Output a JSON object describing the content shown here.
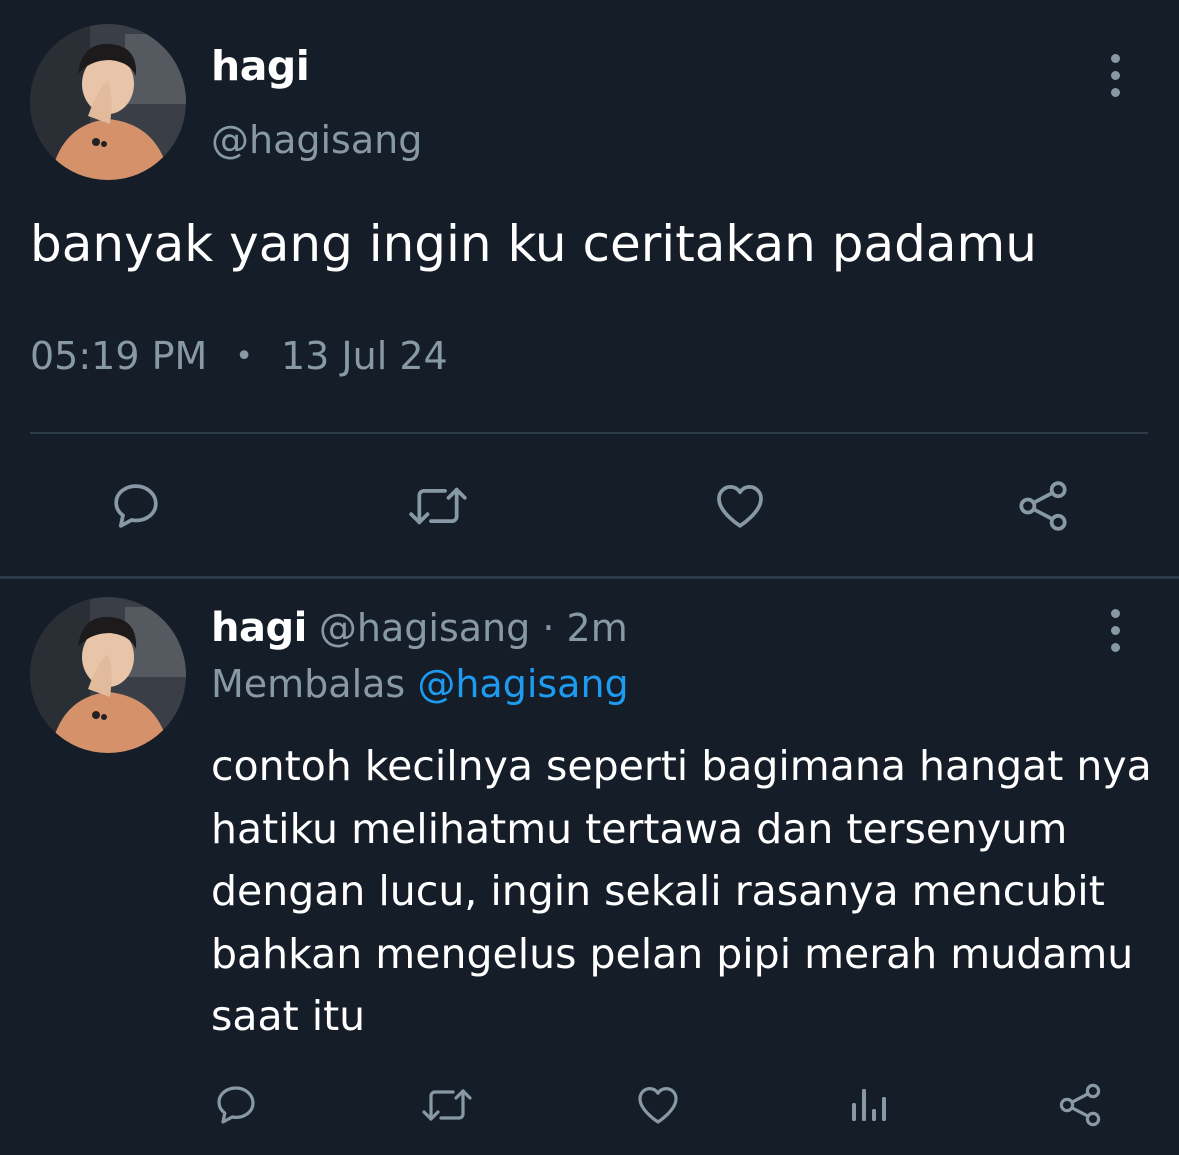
{
  "tweet": {
    "avatar_icon": "user-avatar",
    "name": "hagi",
    "handle": "@hagisang",
    "text": "banyak yang ingin ku ceritakan padamu",
    "time": "05:19 PM",
    "separator": "•",
    "date": "13 Jul 24",
    "actions": [
      {
        "icon": "reply-icon"
      },
      {
        "icon": "retweet-icon"
      },
      {
        "icon": "heart-icon"
      },
      {
        "icon": "share-icon"
      }
    ]
  },
  "reply": {
    "avatar_icon": "user-avatar",
    "name": "hagi",
    "handle": "@hagisang",
    "time_sep": "·",
    "time": "2m",
    "replying_label": "Membalas",
    "replying_to": "@hagisang",
    "text_lines": [
      "contoh kecilnya seperti bagimana hangat nya",
      "hatiku melihatmu tertawa dan tersenyum",
      "dengan lucu, ingin sekali rasanya mencubit",
      "bahkan mengelus pelan pipi merah mudamu",
      "saat itu"
    ],
    "actions": [
      {
        "icon": "reply-icon"
      },
      {
        "icon": "retweet-icon"
      },
      {
        "icon": "heart-icon"
      },
      {
        "icon": "analytics-icon"
      },
      {
        "icon": "share-icon"
      }
    ]
  },
  "colors": {
    "background": "#151d28",
    "text_primary": "#ffffff",
    "text_secondary": "#8899a6",
    "link": "#1d9bf0",
    "divider": "#2d3a48"
  }
}
